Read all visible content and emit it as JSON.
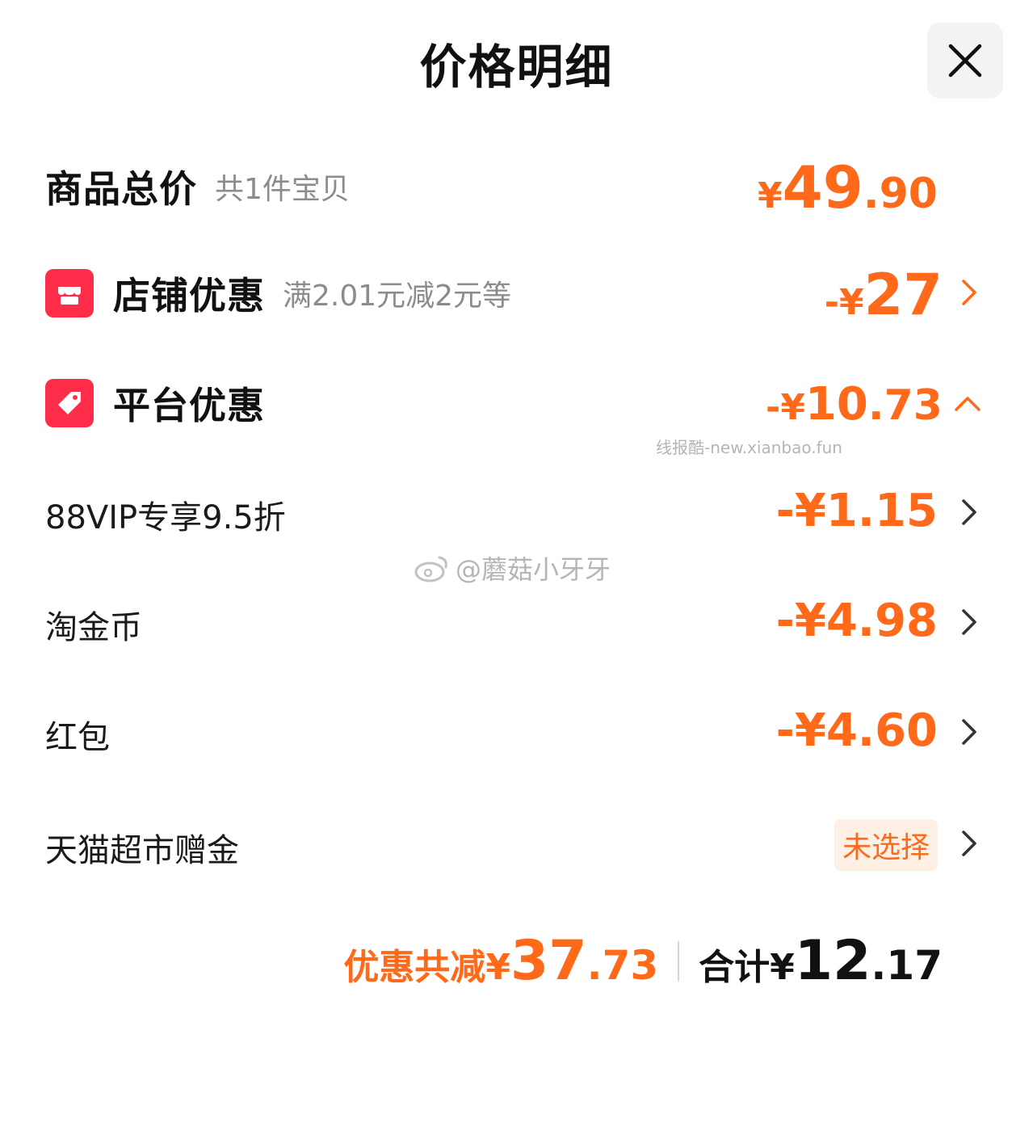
{
  "header": {
    "title": "价格明细"
  },
  "goods_total": {
    "label": "商品总价",
    "sub": "共1件宝贝",
    "yen": "¥",
    "int": "49",
    "dec": ".90"
  },
  "shop_discount": {
    "label": "店铺优惠",
    "sub": "满2.01元减2元等",
    "sign": "-",
    "yen": "¥",
    "amount": "27"
  },
  "platform_discount": {
    "label": "平台优惠",
    "sign": "-",
    "yen": "¥",
    "int": "10",
    "dec": ".73"
  },
  "items": [
    {
      "label": "88VIP专享9.5折",
      "amount": "-¥1.15"
    },
    {
      "label": "淘金币",
      "amount": "-¥4.98"
    },
    {
      "label": "红包",
      "amount": "-¥4.60"
    }
  ],
  "tmall_gift": {
    "label": "天猫超市赠金",
    "badge": "未选择"
  },
  "summary": {
    "discount_label": "优惠共减",
    "discount_yen": "¥",
    "discount_int": "37",
    "discount_dec": ".73",
    "total_label": "合计",
    "total_yen": "¥",
    "total_int": "12",
    "total_dec": ".17"
  },
  "watermarks": {
    "site": "线报酷-new.xianbao.fun",
    "weibo": "@蘑菇小牙牙"
  },
  "colors": {
    "accent": "#ff6a1a",
    "icon_red": "#ff2d4a",
    "badge_bg": "#fff0e6"
  }
}
